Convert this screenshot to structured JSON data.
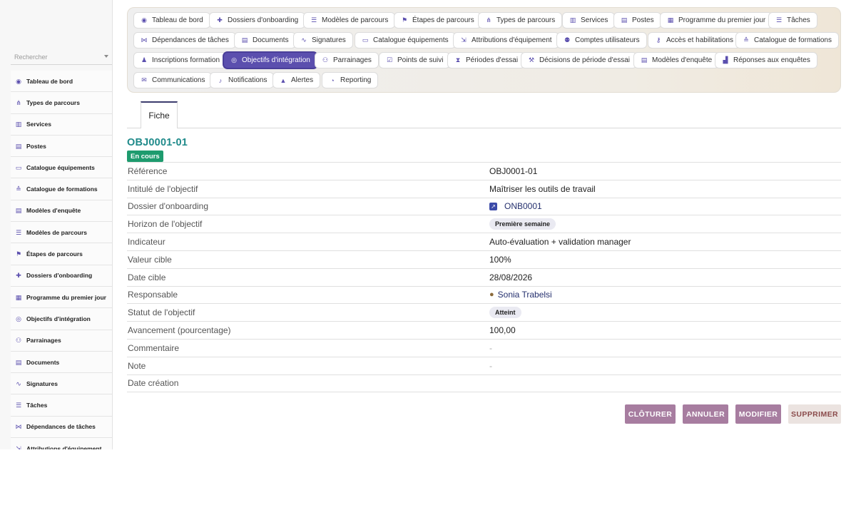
{
  "sidebar": {
    "search_placeholder": "Rechercher",
    "items": [
      {
        "label": "Tableau de bord",
        "icon": "dashboard-icon",
        "glyph": "◉"
      },
      {
        "label": "Types de parcours",
        "icon": "sitemap-icon",
        "glyph": "⋔"
      },
      {
        "label": "Services",
        "icon": "building-icon",
        "glyph": "▥"
      },
      {
        "label": "Postes",
        "icon": "id-badge-icon",
        "glyph": "▤"
      },
      {
        "label": "Catalogue équipements",
        "icon": "laptop-icon",
        "glyph": "▭"
      },
      {
        "label": "Catalogue de formations",
        "icon": "graduation-cap-icon",
        "glyph": "≙"
      },
      {
        "label": "Modèles d'enquête",
        "icon": "clipboard-icon",
        "glyph": "▤"
      },
      {
        "label": "Modèles de parcours",
        "icon": "signpost-icon",
        "glyph": "☰"
      },
      {
        "label": "Étapes de parcours",
        "icon": "flag-icon",
        "glyph": "⚑"
      },
      {
        "label": "Dossiers d'onboarding",
        "icon": "user-plus-icon",
        "glyph": "✚"
      },
      {
        "label": "Programme du premier jour",
        "icon": "calendar-icon",
        "glyph": "▦"
      },
      {
        "label": "Objectifs d'intégration",
        "icon": "target-icon",
        "glyph": "◎"
      },
      {
        "label": "Parrainages",
        "icon": "users-icon",
        "glyph": "⚇"
      },
      {
        "label": "Documents",
        "icon": "file-icon",
        "glyph": "▤"
      },
      {
        "label": "Signatures",
        "icon": "signature-icon",
        "glyph": "∿"
      },
      {
        "label": "Tâches",
        "icon": "list-icon",
        "glyph": "☰"
      },
      {
        "label": "Dépendances de tâches",
        "icon": "diagram-icon",
        "glyph": "⋈"
      },
      {
        "label": "Attributions d'équipement",
        "icon": "dolly-icon",
        "glyph": "⇲"
      }
    ]
  },
  "modules": {
    "row1": [
      {
        "label": "Tableau de bord",
        "icon": "dashboard-icon",
        "glyph": "◉"
      },
      {
        "label": "Dossiers d'onboarding",
        "icon": "user-plus-icon",
        "glyph": "✚"
      },
      {
        "label": "Modèles de parcours",
        "icon": "signpost-icon",
        "glyph": "☰"
      },
      {
        "label": "Étapes de parcours",
        "icon": "flag-icon",
        "glyph": "⚑"
      },
      {
        "label": "Types de parcours",
        "icon": "sitemap-icon",
        "glyph": "⋔"
      },
      {
        "label": "Services",
        "icon": "building-icon",
        "glyph": "▥"
      },
      {
        "label": "Postes",
        "icon": "id-badge-icon",
        "glyph": "▤"
      },
      {
        "label": "Programme du premier jour",
        "icon": "calendar-icon",
        "glyph": "▦"
      },
      {
        "label": "Tâches",
        "icon": "list-icon",
        "glyph": "☰"
      }
    ],
    "row2": [
      {
        "label": "Dépendances de tâches",
        "icon": "diagram-icon",
        "glyph": "⋈"
      },
      {
        "label": "Documents",
        "icon": "file-icon",
        "glyph": "▤"
      },
      {
        "label": "Signatures",
        "icon": "signature-icon",
        "glyph": "∿"
      },
      {
        "label": "Catalogue équipements",
        "icon": "laptop-icon",
        "glyph": "▭"
      },
      {
        "label": "Attributions d'équipement",
        "icon": "dolly-icon",
        "glyph": "⇲"
      },
      {
        "label": "Comptes utilisateurs",
        "icon": "user-gear-icon",
        "glyph": "⚉"
      },
      {
        "label": "Accès et habilitations",
        "icon": "key-icon",
        "glyph": "⚷"
      },
      {
        "label": "Catalogue de formations",
        "icon": "graduation-cap-icon",
        "glyph": "≙"
      }
    ],
    "row3": [
      {
        "label": "Inscriptions formation",
        "icon": "user-tie-icon",
        "glyph": "♟"
      },
      {
        "label": "Objectifs d'intégration",
        "icon": "target-icon",
        "glyph": "◎",
        "active": true
      },
      {
        "label": "Parrainages",
        "icon": "users-icon",
        "glyph": "⚇"
      },
      {
        "label": "Points de suivi",
        "icon": "checklist-icon",
        "glyph": "☑"
      },
      {
        "label": "Périodes d'essai",
        "icon": "hourglass-icon",
        "glyph": "⧗"
      },
      {
        "label": "Décisions de période d'essai",
        "icon": "gavel-icon",
        "glyph": "⚒"
      },
      {
        "label": "Modèles d'enquête",
        "icon": "clipboard-icon",
        "glyph": "▤"
      },
      {
        "label": "Réponses aux enquêtes",
        "icon": "chart-icon",
        "glyph": "▟"
      }
    ],
    "row4": [
      {
        "label": "Communications",
        "icon": "envelope-icon",
        "glyph": "✉"
      },
      {
        "label": "Notifications",
        "icon": "bell-icon",
        "glyph": "♪"
      },
      {
        "label": "Alertes",
        "icon": "warning-icon",
        "glyph": "▲"
      },
      {
        "label": "Reporting",
        "icon": "pie-chart-icon",
        "glyph": "◔"
      }
    ]
  },
  "tabs": {
    "fiche": "Fiche"
  },
  "record": {
    "title": "OBJ0001-01",
    "status": "En cours",
    "fields": [
      {
        "key": "Référence",
        "value": "OBJ0001-01",
        "kind": "text"
      },
      {
        "key": "Intitulé de l'objectif",
        "value": "Maîtriser les outils de travail",
        "kind": "text"
      },
      {
        "key": "Dossier d'onboarding",
        "value": "ONB0001",
        "kind": "record-link",
        "icon": "onboarding-record-icon"
      },
      {
        "key": "Horizon de l'objectif",
        "value": "Première semaine",
        "kind": "pill"
      },
      {
        "key": "Indicateur",
        "value": "Auto-évaluation + validation manager",
        "kind": "text"
      },
      {
        "key": "Valeur cible",
        "value": "100%",
        "kind": "text"
      },
      {
        "key": "Date cible",
        "value": "28/08/2026",
        "kind": "text"
      },
      {
        "key": "Responsable",
        "value": "Sonia Trabelsi",
        "kind": "person-link",
        "icon": "user-icon"
      },
      {
        "key": "Statut de l'objectif",
        "value": "Atteint",
        "kind": "pill"
      },
      {
        "key": "Avancement (pourcentage)",
        "value": "100,00",
        "kind": "text"
      },
      {
        "key": "Commentaire",
        "value": "-",
        "kind": "muted"
      },
      {
        "key": "Note",
        "value": "-",
        "kind": "muted"
      },
      {
        "key": "Date création",
        "value": "",
        "kind": "text"
      }
    ]
  },
  "actions": {
    "close": "CLÔTURER",
    "cancel": "ANNULER",
    "edit": "MODIFIER",
    "delete": "SUPPRIMER"
  },
  "colors": {
    "accent": "#5b4fae",
    "title": "#1f8a8a",
    "status": "#1e9b6e",
    "action": "#a77da0"
  }
}
